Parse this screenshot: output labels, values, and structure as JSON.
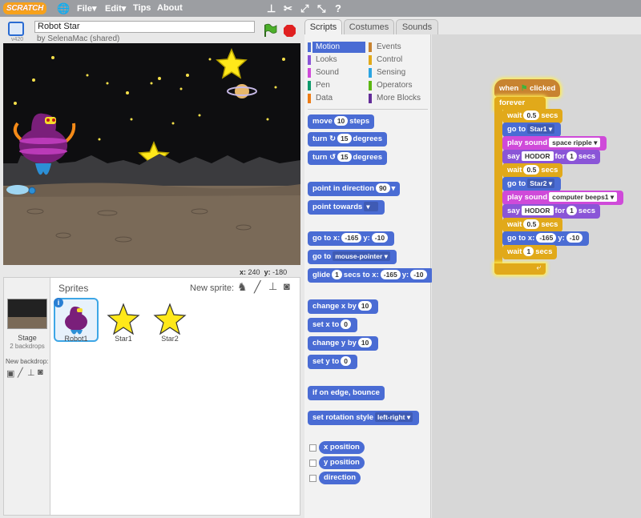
{
  "menubar": {
    "logo": "SCRATCH",
    "file": "File",
    "edit": "Edit",
    "tips": "Tips",
    "about": "About"
  },
  "project": {
    "title": "Robot Star",
    "author": "by SelenaMac (shared)",
    "version": "v420"
  },
  "stage": {
    "x_label": "x:",
    "x": "240",
    "y_label": "y:",
    "y": "-180"
  },
  "sprites": {
    "header": "Sprites",
    "new_sprite": "New sprite:",
    "stage_label": "Stage",
    "backdrops": "2 backdrops",
    "new_backdrop": "New backdrop:",
    "items": [
      {
        "name": "Robot1"
      },
      {
        "name": "Star1"
      },
      {
        "name": "Star2"
      }
    ]
  },
  "tabs": [
    "Scripts",
    "Costumes",
    "Sounds"
  ],
  "categories": [
    {
      "name": "Motion",
      "color": "#4a6cd4"
    },
    {
      "name": "Events",
      "color": "#c88330"
    },
    {
      "name": "Looks",
      "color": "#8a55d7"
    },
    {
      "name": "Control",
      "color": "#e1a91a"
    },
    {
      "name": "Sound",
      "color": "#cf4ad9"
    },
    {
      "name": "Sensing",
      "color": "#2ca5e2"
    },
    {
      "name": "Pen",
      "color": "#0e9a6c"
    },
    {
      "name": "Operators",
      "color": "#5cb712"
    },
    {
      "name": "Data",
      "color": "#ee7d16"
    },
    {
      "name": "More Blocks",
      "color": "#632d99"
    }
  ],
  "palette": {
    "move": "move",
    "move_val": "10",
    "steps": "steps",
    "turn": "turn",
    "turn_cw_val": "15",
    "turn_ccw_val": "15",
    "degrees": "degrees",
    "point_dir": "point in direction",
    "point_dir_val": "90",
    "point_towards": "point towards",
    "goto": "go to x:",
    "goto_x": "-165",
    "y_label": "y:",
    "goto_y": "-10",
    "goto_ptr": "go to",
    "goto_ptr_val": "mouse-pointer",
    "glide": "glide",
    "glide_secs": "1",
    "glide_mid": "secs to x:",
    "glide_x": "-165",
    "glide_y": "-10",
    "change_x": "change x by",
    "change_x_val": "10",
    "set_x": "set x to",
    "set_x_val": "0",
    "change_y": "change y by",
    "change_y_val": "10",
    "set_y": "set y to",
    "set_y_val": "0",
    "edge": "if on edge, bounce",
    "rot_style": "set rotation style",
    "rot_style_val": "left-right",
    "x_position": "x position",
    "y_position": "y position",
    "direction": "direction"
  },
  "script": {
    "when": "when",
    "clicked": "clicked",
    "forever": "forever",
    "wait": "wait",
    "secs": "secs",
    "wait1": "0.5",
    "goto": "go to",
    "target1": "Star1",
    "play": "play sound",
    "sound1": "space ripple",
    "say": "say",
    "say_text": "HODOR",
    "for": "for",
    "say_secs": "1",
    "wait2": "0.5",
    "target2": "Star2",
    "sound2": "computer beeps1",
    "wait3": "0.5",
    "gotox": "go to x:",
    "gx": "-165",
    "y": "y:",
    "gy": "-10",
    "wait4": "1"
  }
}
